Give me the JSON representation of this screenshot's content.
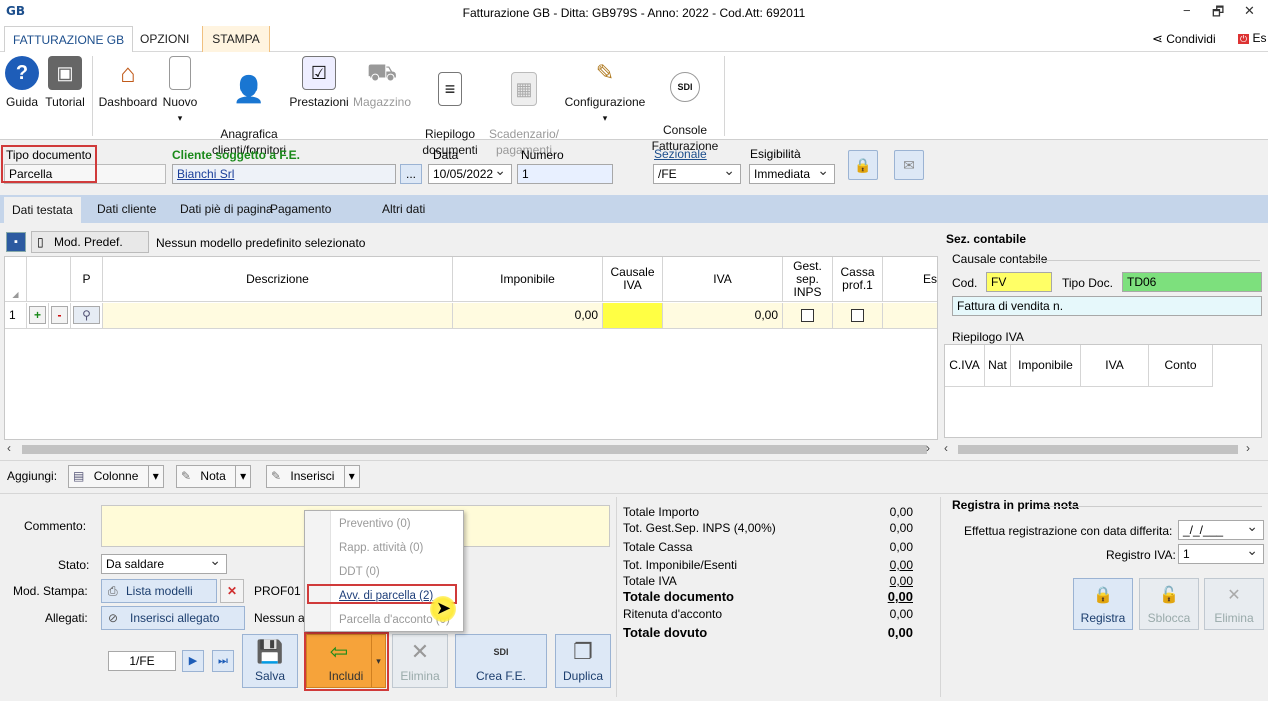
{
  "window": {
    "logo": "GB",
    "title": "Fatturazione GB - Ditta: GB979S - Anno: 2022 - Cod.Att: 692011",
    "minimize": "−",
    "restore": "🗗",
    "close": "✕"
  },
  "ribbon_tabs": [
    "FATTURAZIONE GB",
    "OPZIONI",
    "STAMPA"
  ],
  "share": {
    "label": "Condividi",
    "exit": "Es"
  },
  "ribbon": {
    "guida": "Guida",
    "tutorial": "Tutorial",
    "dashboard": "Dashboard",
    "nuovo": "Nuovo",
    "anagrafica": "Anagrafica\nclienti/fornitori",
    "prestazioni": "Prestazioni",
    "magazzino": "Magazzino",
    "riepilogo": "Riepilogo\ndocumenti",
    "scadenzario": "Scadenzario/\npagamenti",
    "configurazione": "Configurazione",
    "console": "Console\nFatturazione",
    "sdi_badge": "SDI"
  },
  "header": {
    "tipo_label": "Tipo documento",
    "tipo_value": "Parcella",
    "cliente_label": "Cliente soggetto a F.E.",
    "cliente_value": "Bianchi Srl",
    "browse": "...",
    "data_label": "Data",
    "data_value": "10/05/2022",
    "numero_label": "Numero",
    "numero_value": "1",
    "sezionale_label": "Sezionale",
    "sezionale_value": "/FE",
    "esigibilita_label": "Esigibilità",
    "esigibilita_value": "Immediata"
  },
  "content_tabs": [
    "Dati testata",
    "Dati cliente",
    "Dati piè di pagina",
    "Pagamento",
    "Altri dati"
  ],
  "model_bar": {
    "button": "Mod. Predef.",
    "text": "Nessun modello predefinito selezionato"
  },
  "grid": {
    "columns": [
      "P",
      "Descrizione",
      "Imponibile",
      "Causale IVA",
      "IVA",
      "Gest. sep. INPS",
      "Cassa prof.1",
      "Es"
    ],
    "rows": [
      {
        "num": "1",
        "plus": "+",
        "minus": "-",
        "imponibile": "0,00",
        "iva": "0,00"
      }
    ]
  },
  "right_panel": {
    "title": "Sez. contabile",
    "causale_label": "Causale contabile",
    "cod_label": "Cod.",
    "cod_value": "FV",
    "tipo_doc_label": "Tipo Doc.",
    "tipo_doc_value": "TD06",
    "descr_value": "Fattura di vendita n.",
    "riepilogo_label": "Riepilogo IVA",
    "riepilogo_cols": [
      "C.IVA",
      "Nat",
      "Imponibile",
      "IVA",
      "Conto"
    ]
  },
  "aggiungi": {
    "label": "Aggiungi:",
    "colonne": "Colonne",
    "nota": "Nota",
    "inserisci": "Inserisci"
  },
  "bottom": {
    "commento_label": "Commento:",
    "stato_label": "Stato:",
    "stato_value": "Da saldare",
    "mod_stampa_label": "Mod. Stampa:",
    "lista_modelli": "Lista modelli",
    "prof_text": "PROF01 -",
    "allegati_label": "Allegati:",
    "inserisci_allegato": "Inserisci allegato",
    "nessun_text": "Nessun al",
    "nav_value": "1/FE",
    "salva": "Salva",
    "includi": "Includi",
    "elimina": "Elimina",
    "crea_fe": "Crea F.E.",
    "duplica": "Duplica"
  },
  "menu": {
    "items": [
      "Preventivo (0)",
      "Rapp. attività (0)",
      "DDT (0)",
      "Avv. di parcella (2)",
      "Parcella d'acconto (0)"
    ]
  },
  "totals": {
    "labels": [
      "Totale Importo",
      "Tot. Gest.Sep. INPS (4,00%)",
      "Totale Cassa",
      "Tot. Imponibile/Esenti",
      "Totale IVA",
      "Totale documento",
      "Ritenuta d'acconto",
      "Totale dovuto"
    ],
    "values": [
      "0,00",
      "0,00",
      "0,00",
      "0,00",
      "0,00",
      "0,00",
      "0,00",
      "0,00"
    ]
  },
  "prima_nota": {
    "title": "Registra in prima nota",
    "differita_label": "Effettua registrazione con data differita:",
    "differita_value": "_/_/___",
    "registro_label": "Registro IVA:",
    "registro_value": "1",
    "registra": "Registra",
    "sblocca": "Sblocca",
    "elimina": "Elimina"
  },
  "colors": {
    "accent": "#1c4e8c",
    "highlight_red": "#d03a3a",
    "cod_yellow": "#ffff66",
    "tipo_green": "#7de07d",
    "cell_yellow": "#ffff44"
  }
}
